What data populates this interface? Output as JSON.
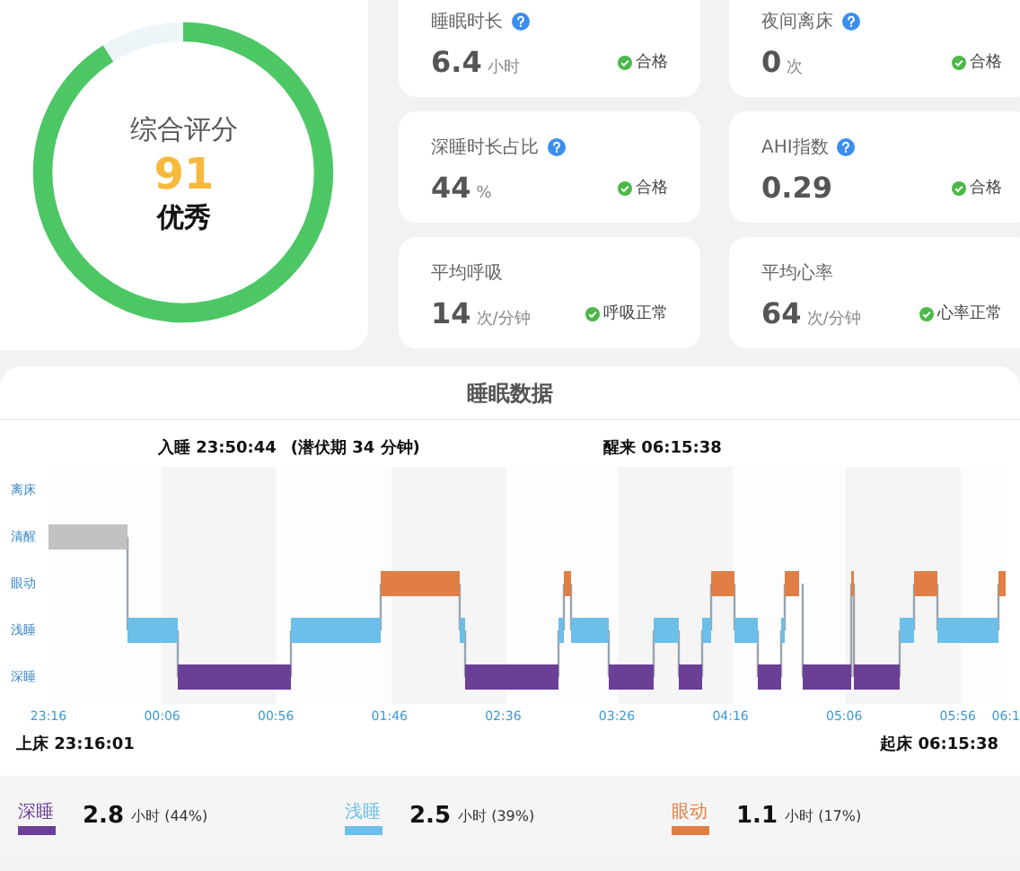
{
  "score": {
    "title": "综合评分",
    "value": "91",
    "grade": "优秀",
    "level": 0.91
  },
  "metrics": [
    {
      "title": "睡眠时长",
      "help": true,
      "value": "6.4",
      "unit": "小时",
      "status": "合格"
    },
    {
      "title": "夜间离床",
      "help": true,
      "value": "0",
      "unit": "次",
      "status": "合格"
    },
    {
      "title": "深睡时长占比",
      "help": true,
      "value": "44",
      "unit": "%",
      "status": "合格"
    },
    {
      "title": "AHI指数",
      "help": true,
      "value": "0.29",
      "status": "合格"
    },
    {
      "title": "平均呼吸",
      "help": false,
      "value": "14",
      "unit": "次/分钟",
      "status": "呼吸正常"
    },
    {
      "title": "平均心率",
      "help": false,
      "value": "64",
      "unit": "次/分钟",
      "status": "心率正常"
    }
  ],
  "sleep_data": {
    "title": "睡眠数据",
    "sleep_onset": "入睡 23:50:44",
    "latency": "(潜伏期 34 分钟)",
    "wake": "醒来 06:15:38",
    "stage_labels": [
      "离床",
      "清醒",
      "眼动",
      "浅睡",
      "深睡"
    ],
    "time_ticks": [
      "23:16",
      "00:06",
      "00:56",
      "01:46",
      "02:36",
      "03:26",
      "04:16",
      "05:06",
      "05:56",
      "06:1"
    ],
    "bed_time": "上床 23:16:01",
    "rise_time": "起床 06:15:38"
  },
  "legend": [
    {
      "stage": "深睡",
      "color": "#6c3f96",
      "value": "2.8",
      "detail": "小时 (44%)"
    },
    {
      "stage": "浅睡",
      "color": "#6bbfe8",
      "value": "2.5",
      "detail": "小时 (39%)"
    },
    {
      "stage": "眼动",
      "color": "#e07e45",
      "value": "1.1",
      "detail": "小时 (17%)"
    }
  ]
}
